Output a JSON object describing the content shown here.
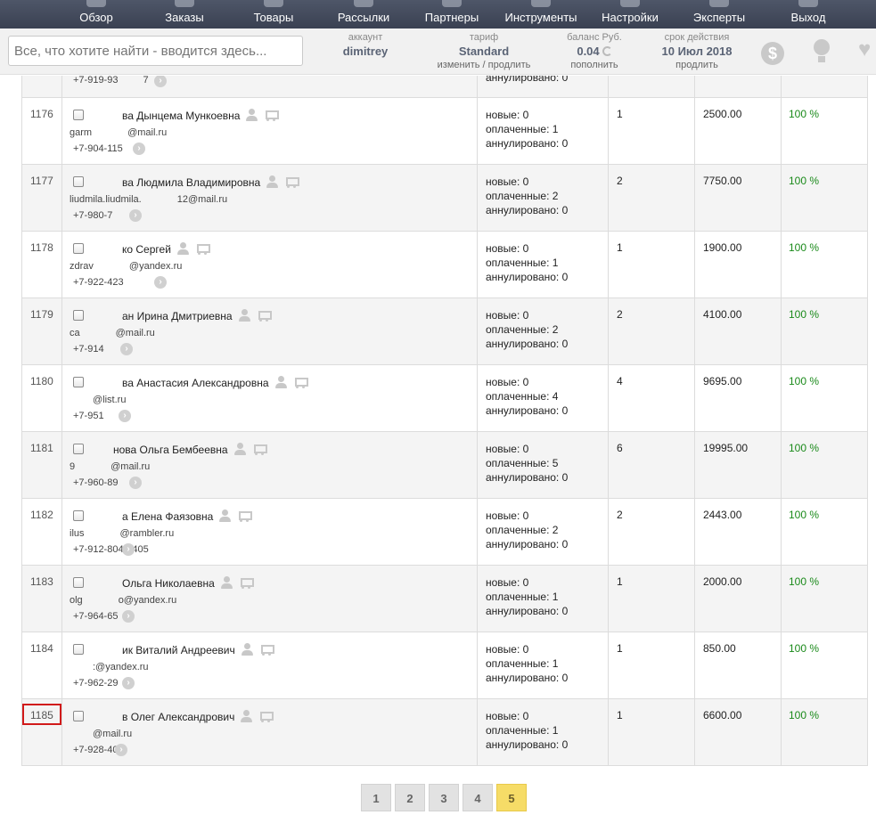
{
  "nav": {
    "items": [
      {
        "label": "Обзор"
      },
      {
        "label": "Заказы"
      },
      {
        "label": "Товары"
      },
      {
        "label": "Рассылки"
      },
      {
        "label": "Партнеры"
      },
      {
        "label": "Инструменты"
      },
      {
        "label": "Настройки"
      },
      {
        "label": "Эксперты"
      },
      {
        "label": "Выход"
      }
    ]
  },
  "search": {
    "placeholder": "Все, что хотите найти - вводится здесь..."
  },
  "account": {
    "caption": "аккаунт",
    "value": "dimitrey"
  },
  "tariff": {
    "caption": "тариф",
    "value": "Standard",
    "action": "изменить / продлить"
  },
  "balance": {
    "caption": "баланс Руб.",
    "value": "0.04",
    "action": "пополнить"
  },
  "expiry": {
    "caption": "срок действия",
    "value": "10 Июл 2018",
    "action": "продлить"
  },
  "toolbar_icons": [
    "money-bag-icon",
    "lightbulb-icon",
    "heart-icon"
  ],
  "partial_row": {
    "phone": "+7-919-93",
    "phone_end": "7",
    "status_tail": "аннулировано: 0"
  },
  "status_labels": {
    "new": "новые:",
    "paid": "оплаченные:",
    "cancelled": "аннулировано:"
  },
  "rows": [
    {
      "id": "1176",
      "name_visible": "ва Дынцема Мункоевна",
      "email_a": "garm",
      "email_b": "@mail.ru",
      "phone_a": "+7-904-115",
      "new": "0",
      "paid": "1",
      "cancelled": "0",
      "count": "1",
      "sum": "2500.00",
      "pct": "100 %"
    },
    {
      "id": "1177",
      "name_visible": "ва Людмила Владимировна",
      "email_a": "liudmila.liudmila.",
      "email_b": "12@mail.ru",
      "phone_a": "+7-980-7",
      "new": "0",
      "paid": "2",
      "cancelled": "0",
      "count": "2",
      "sum": "7750.00",
      "pct": "100 %"
    },
    {
      "id": "1178",
      "name_visible": "ко Сергей",
      "email_a": "zdrav",
      "email_b": "@yandex.ru",
      "phone_a": "+7-922-423",
      "new": "0",
      "paid": "1",
      "cancelled": "0",
      "count": "1",
      "sum": "1900.00",
      "pct": "100 %"
    },
    {
      "id": "1179",
      "name_visible": "ан Ирина Дмитриевна",
      "email_a": "ca",
      "email_b": "@mail.ru",
      "phone_a": "+7-914",
      "new": "0",
      "paid": "2",
      "cancelled": "0",
      "count": "2",
      "sum": "4100.00",
      "pct": "100 %"
    },
    {
      "id": "1180",
      "name_visible": "ва Анастасия Александровна",
      "email_a": "",
      "email_b": "@list.ru",
      "phone_a": "+7-951",
      "new": "0",
      "paid": "4",
      "cancelled": "0",
      "count": "4",
      "sum": "9695.00",
      "pct": "100 %"
    },
    {
      "id": "1181",
      "name_visible": "нова Ольга Бембеевна",
      "email_a": "9",
      "email_b": "@mail.ru",
      "phone_a": "+7-960-89",
      "new": "0",
      "paid": "5",
      "cancelled": "0",
      "count": "6",
      "sum": "19995.00",
      "pct": "100 %"
    },
    {
      "id": "1182",
      "name_visible": "а Елена Фаязовна",
      "email_a": "ilus",
      "email_b": "@rambler.ru",
      "phone_a": "+7-912-804-3405",
      "new": "0",
      "paid": "2",
      "cancelled": "0",
      "count": "2",
      "sum": "2443.00",
      "pct": "100 %"
    },
    {
      "id": "1183",
      "name_visible": "Ольга Николаевна",
      "email_a": "olg",
      "email_b": "o@yandex.ru",
      "phone_a": "+7-964-65",
      "new": "0",
      "paid": "1",
      "cancelled": "0",
      "count": "1",
      "sum": "2000.00",
      "pct": "100 %"
    },
    {
      "id": "1184",
      "name_visible": "ик Виталий Андреевич",
      "email_a": "",
      "email_b": ":@yandex.ru",
      "phone_a": "+7-962-29",
      "new": "0",
      "paid": "1",
      "cancelled": "0",
      "count": "1",
      "sum": "850.00",
      "pct": "100 %"
    },
    {
      "id": "1185",
      "name_visible": "в Олег Александрович",
      "email_a": "",
      "email_b": "@mail.ru",
      "phone_a": "+7-928-408-",
      "new": "0",
      "paid": "1",
      "cancelled": "0",
      "count": "1",
      "sum": "6600.00",
      "pct": "100 %",
      "highlight": true
    }
  ],
  "pagination": {
    "pages": [
      "1",
      "2",
      "3",
      "4",
      "5"
    ],
    "current": "5"
  }
}
